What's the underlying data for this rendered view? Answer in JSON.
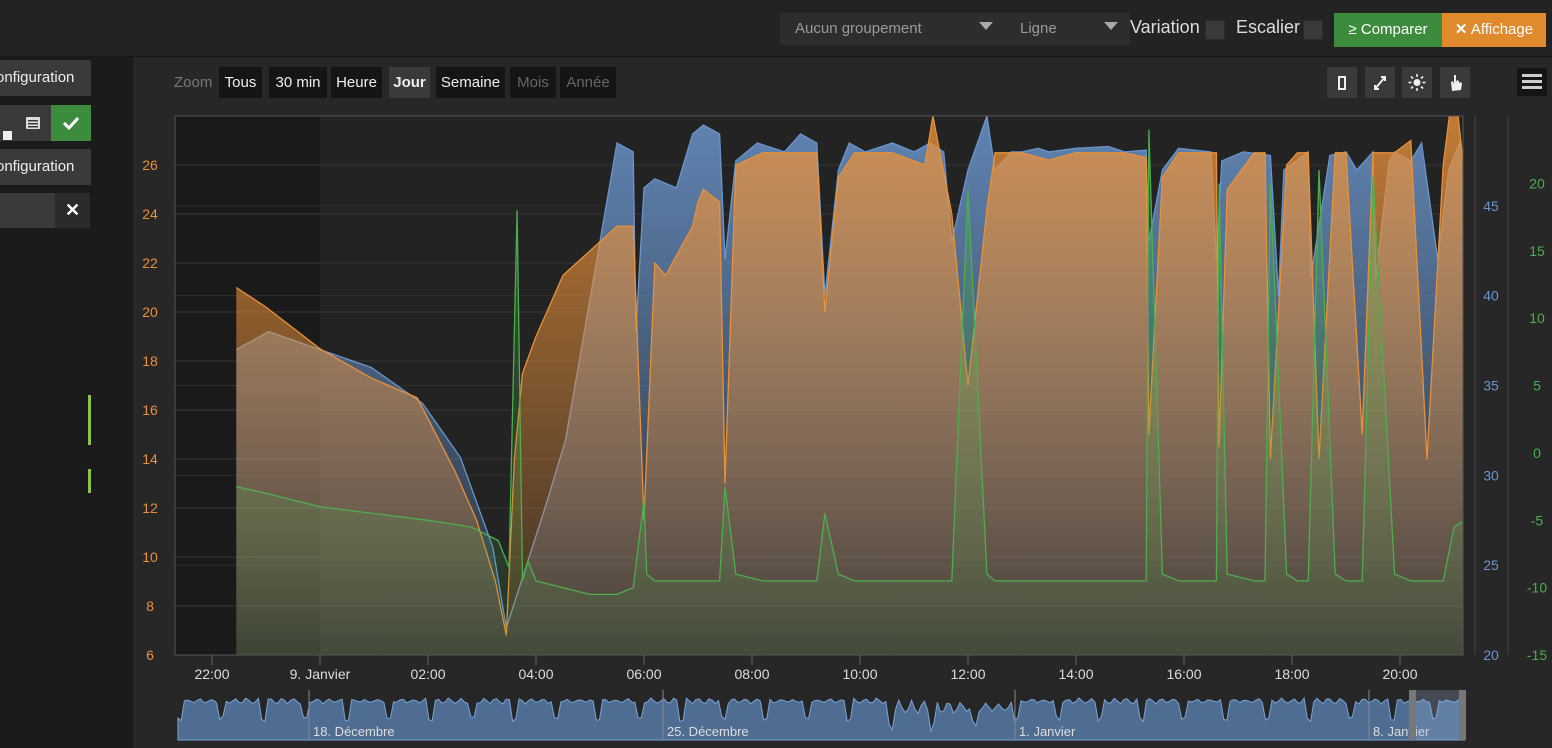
{
  "toolbar": {
    "grouping": "Aucun groupement",
    "charttype": "Ligne",
    "variation": "Variation",
    "escalier": "Escalier",
    "compare": "Comparer",
    "affichage": "Affichage"
  },
  "sidebar": {
    "config1": "onfiguration",
    "config2": "onfiguration"
  },
  "zoom": {
    "label": "Zoom",
    "buttons": [
      "Tous",
      "30 min",
      "Heure",
      "Jour",
      "Semaine",
      "Mois",
      "Année"
    ],
    "active": "Jour",
    "disabled": [
      "Mois",
      "Année"
    ]
  },
  "chart_data": {
    "type": "area",
    "x_ticks": [
      "22:00",
      "9. Janvier",
      "02:00",
      "04:00",
      "06:00",
      "08:00",
      "10:00",
      "12:00",
      "14:00",
      "16:00",
      "18:00",
      "20:00"
    ],
    "y_left": {
      "ticks": [
        6,
        8,
        10,
        12,
        14,
        16,
        18,
        20,
        22,
        24,
        26
      ],
      "range": [
        6,
        28
      ],
      "color": "#e8903a"
    },
    "y_right1": {
      "ticks": [
        20,
        25,
        30,
        35,
        40,
        45
      ],
      "range": [
        20,
        50
      ],
      "color": "#6a95cc"
    },
    "y_right2": {
      "ticks": [
        -15,
        -10,
        -5,
        0,
        5,
        10,
        15,
        20
      ],
      "range": [
        -15,
        25
      ],
      "color": "#4cae4c"
    },
    "series": [
      {
        "color": "#6a95cc",
        "axis": "right1",
        "x": [
          -1.55,
          -0.95,
          0,
          0.95,
          1.9,
          2.6,
          3.2,
          3.45,
          4.2,
          4.55,
          5.5,
          5.8,
          5.85,
          6.0,
          6.2,
          6.6,
          6.9,
          7.1,
          7.4,
          7.5,
          7.7,
          8.1,
          8.6,
          8.9,
          9.2,
          9.35,
          9.6,
          9.8,
          10.1,
          10.6,
          11.0,
          11.3,
          11.55,
          11.7,
          12.0,
          12.35,
          12.5,
          12.8,
          13.0,
          13.3,
          13.5,
          14.0,
          14.6,
          14.9,
          15.3,
          15.35,
          15.6,
          15.9,
          16.5,
          16.6,
          16.7,
          17.1,
          17.6,
          17.75,
          17.85,
          18.3,
          18.35,
          18.7,
          19.0,
          19.2,
          19.5,
          19.55,
          19.8,
          19.9,
          20.2,
          20.4,
          20.7,
          20.9,
          21.1,
          21.2
        ],
        "y": [
          37,
          38,
          37,
          36,
          34,
          31,
          26,
          21.5,
          28.5,
          32,
          48.5,
          48,
          38,
          46,
          46.5,
          46,
          49,
          49.5,
          49,
          42,
          47.5,
          48.5,
          48,
          49,
          48.5,
          40,
          47,
          48.5,
          48,
          48.5,
          48,
          48.5,
          48,
          43,
          47,
          50,
          47,
          48,
          48,
          48.2,
          48,
          48.2,
          48.3,
          48,
          48.1,
          43,
          47,
          48.2,
          48,
          42,
          47.5,
          48,
          47.8,
          40,
          47,
          48,
          41,
          47.8,
          48,
          47,
          48,
          41,
          47.5,
          48,
          47.5,
          48.5,
          42,
          47,
          48.5,
          47.5
        ]
      },
      {
        "color": "#e8903a",
        "axis": "left",
        "x": [
          -1.55,
          -1.0,
          0,
          0.95,
          1.8,
          2.5,
          2.9,
          3.25,
          3.45,
          3.6,
          3.75,
          4.0,
          4.5,
          5.0,
          5.5,
          5.8,
          6.0,
          6.2,
          6.4,
          6.9,
          7.0,
          7.1,
          7.4,
          7.5,
          7.7,
          8.2,
          8.6,
          8.9,
          9.2,
          9.35,
          9.6,
          9.9,
          10.6,
          11.2,
          11.35,
          11.7,
          12.0,
          12.35,
          12.5,
          12.75,
          13.0,
          13.5,
          14.0,
          14.6,
          14.9,
          15.3,
          15.35,
          15.6,
          15.9,
          16.6,
          16.65,
          16.8,
          17.3,
          17.5,
          17.6,
          17.9,
          18.1,
          18.3,
          18.5,
          18.8,
          19.0,
          19.3,
          19.5,
          19.9,
          20.2,
          20.5,
          20.8,
          21.0,
          21.2
        ],
        "y": [
          21,
          20.2,
          18.5,
          17.3,
          16.5,
          13.5,
          11.5,
          9.0,
          6.8,
          14,
          17.5,
          19,
          21.5,
          22.5,
          23.5,
          23.5,
          11.5,
          22,
          21.5,
          23.5,
          24.5,
          25,
          24.5,
          13,
          26,
          26.5,
          26.5,
          26.5,
          26.5,
          20,
          25.5,
          26.5,
          26.5,
          26,
          28,
          24,
          17,
          24.2,
          26.5,
          26.5,
          26.5,
          26.2,
          26.5,
          26.5,
          26.5,
          26.3,
          15,
          25.5,
          26.5,
          26.5,
          14.5,
          25,
          26.5,
          26.5,
          14,
          26,
          26.5,
          26.5,
          14,
          26.5,
          26.5,
          15,
          26.5,
          26.5,
          27,
          14,
          26,
          29.5,
          25.5
        ]
      },
      {
        "color": "#4cae4c",
        "axis": "right2",
        "x": [
          -1.55,
          -1.0,
          0,
          1.0,
          2.0,
          2.8,
          3.3,
          3.5,
          3.65,
          3.75,
          3.85,
          4.0,
          4.5,
          5.0,
          5.5,
          5.8,
          6.0,
          6.05,
          6.2,
          6.9,
          7.1,
          7.4,
          7.5,
          7.7,
          8.2,
          8.6,
          8.9,
          9.2,
          9.35,
          9.6,
          9.9,
          10.6,
          11.2,
          11.35,
          11.7,
          12.0,
          12.35,
          12.5,
          12.8,
          13.0,
          13.5,
          14.0,
          14.6,
          14.9,
          15.3,
          15.35,
          15.6,
          15.9,
          16.6,
          16.65,
          16.8,
          17.3,
          17.5,
          17.6,
          17.9,
          18.1,
          18.3,
          18.5,
          18.8,
          19.0,
          19.3,
          19.5,
          19.9,
          20.2,
          20.5,
          20.8,
          21.0,
          21.2
        ],
        "y": [
          -2.5,
          -3.0,
          -4.0,
          -4.5,
          -5.0,
          -5.5,
          -6.5,
          -8.5,
          18,
          -9.5,
          -8.0,
          -9.5,
          -10.0,
          -10.5,
          -10.5,
          -10.0,
          -3.5,
          -9.0,
          -9.5,
          -9.5,
          -9.5,
          -9.5,
          -2.5,
          -9.0,
          -9.5,
          -9.5,
          -9.5,
          -9.5,
          -4.5,
          -9.0,
          -9.5,
          -9.5,
          -9.5,
          -9.5,
          -9.5,
          19.5,
          -9.0,
          -9.5,
          -9.5,
          -9.5,
          -9.5,
          -9.5,
          -9.5,
          -9.5,
          -9.5,
          24,
          -9.0,
          -9.5,
          -9.5,
          20,
          -9.0,
          -9.5,
          -9.5,
          20,
          -9.0,
          -9.5,
          -9.5,
          21,
          -9.0,
          -9.5,
          -9.5,
          20.5,
          -9.0,
          -9.5,
          -9.5,
          -9.5,
          -5.5,
          -5.0
        ]
      }
    ],
    "navigator": {
      "labels": [
        "18. Décembre",
        "25. Décembre",
        "1. Janvier",
        "8. Janvier"
      ]
    }
  }
}
